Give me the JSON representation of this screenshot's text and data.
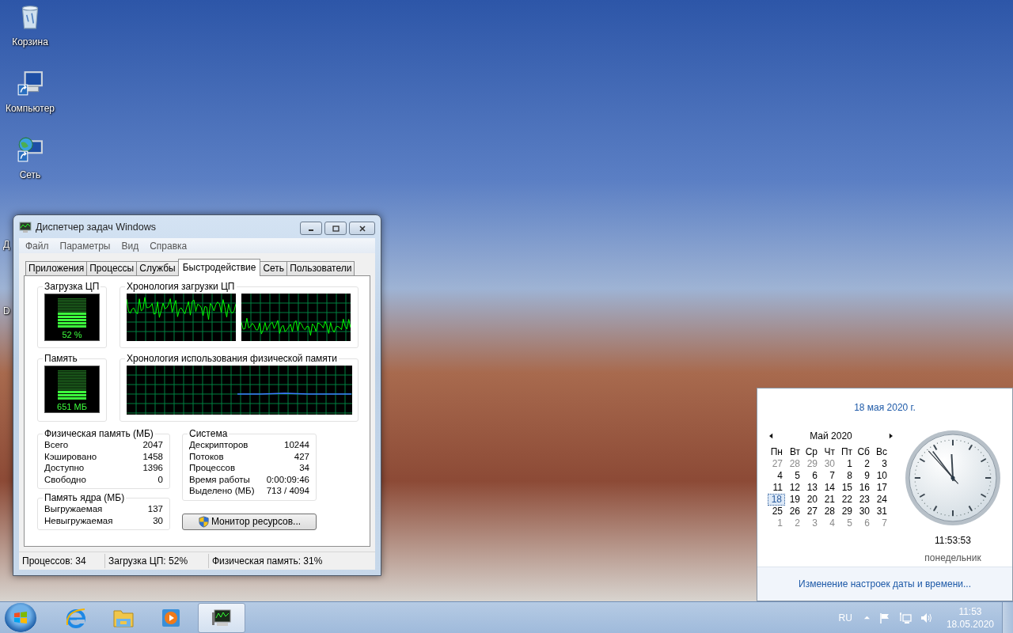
{
  "desktop_icons": [
    {
      "kind": "icon",
      "label": "Корзина"
    },
    {
      "kind": "icon",
      "label": "Компьютер"
    },
    {
      "kind": "icon",
      "label": "Сеть"
    },
    {
      "kind": "clipped",
      "label": "Д"
    },
    {
      "kind": "clipped",
      "label": "D"
    }
  ],
  "task_manager": {
    "title": "Диспетчер задач Windows",
    "menu": [
      "Файл",
      "Параметры",
      "Вид",
      "Справка"
    ],
    "tabs": [
      {
        "label": "Приложения",
        "selected": false
      },
      {
        "label": "Процессы",
        "selected": false
      },
      {
        "label": "Службы",
        "selected": false
      },
      {
        "label": "Быстродействие",
        "selected": true
      },
      {
        "label": "Сеть",
        "selected": false
      },
      {
        "label": "Пользователи",
        "selected": false
      }
    ],
    "cpu_usage": {
      "title": "Загрузка ЦП",
      "reading": "52 %",
      "level": 0.52
    },
    "cpu_history": {
      "title": "Хронология загрузки ЦП"
    },
    "memory": {
      "title": "Память",
      "reading": "651 МБ",
      "level": 0.31
    },
    "memory_history": {
      "title": "Хронология использования физической памяти"
    },
    "physical_memory": {
      "title": "Физическая память (МБ)",
      "rows": [
        {
          "label": "Всего",
          "value": "2047"
        },
        {
          "label": "Кэшировано",
          "value": "1458"
        },
        {
          "label": "Доступно",
          "value": "1396"
        },
        {
          "label": "Свободно",
          "value": "0"
        }
      ]
    },
    "kernel_memory": {
      "title": "Память ядра (МБ)",
      "rows": [
        {
          "label": "Выгружаемая",
          "value": "137"
        },
        {
          "label": "Невыгружаемая",
          "value": "30"
        }
      ]
    },
    "system": {
      "title": "Система",
      "rows": [
        {
          "label": "Дескрипторов",
          "value": "10244"
        },
        {
          "label": "Потоков",
          "value": "427"
        },
        {
          "label": "Процессов",
          "value": "34"
        },
        {
          "label": "Время работы",
          "value": "0:00:09:46"
        },
        {
          "label": "Выделено (МБ)",
          "value": "713 / 4094"
        }
      ]
    },
    "resource_monitor_button": "Монитор ресурсов...",
    "status_bar": [
      "Процессов: 34",
      "Загрузка ЦП: 52%",
      "Физическая память: 31%"
    ]
  },
  "calendar": {
    "date_link": "18 мая 2020 г.",
    "month": "Май 2020",
    "weekdays": [
      "Пн",
      "Вт",
      "Ср",
      "Чт",
      "Пт",
      "Сб",
      "Вс"
    ],
    "days": [
      {
        "label": "27",
        "in_month": false,
        "selected": false
      },
      {
        "label": "28",
        "in_month": false,
        "selected": false
      },
      {
        "label": "29",
        "in_month": false,
        "selected": false
      },
      {
        "label": "30",
        "in_month": false,
        "selected": false
      },
      {
        "label": "1",
        "in_month": true,
        "selected": false
      },
      {
        "label": "2",
        "in_month": true,
        "selected": false
      },
      {
        "label": "3",
        "in_month": true,
        "selected": false
      },
      {
        "label": "4",
        "in_month": true,
        "selected": false
      },
      {
        "label": "5",
        "in_month": true,
        "selected": false
      },
      {
        "label": "6",
        "in_month": true,
        "selected": false
      },
      {
        "label": "7",
        "in_month": true,
        "selected": false
      },
      {
        "label": "8",
        "in_month": true,
        "selected": false
      },
      {
        "label": "9",
        "in_month": true,
        "selected": false
      },
      {
        "label": "10",
        "in_month": true,
        "selected": false
      },
      {
        "label": "11",
        "in_month": true,
        "selected": false
      },
      {
        "label": "12",
        "in_month": true,
        "selected": false
      },
      {
        "label": "13",
        "in_month": true,
        "selected": false
      },
      {
        "label": "14",
        "in_month": true,
        "selected": false
      },
      {
        "label": "15",
        "in_month": true,
        "selected": false
      },
      {
        "label": "16",
        "in_month": true,
        "selected": false
      },
      {
        "label": "17",
        "in_month": true,
        "selected": false
      },
      {
        "label": "18",
        "in_month": true,
        "selected": true
      },
      {
        "label": "19",
        "in_month": true,
        "selected": false
      },
      {
        "label": "20",
        "in_month": true,
        "selected": false
      },
      {
        "label": "21",
        "in_month": true,
        "selected": false
      },
      {
        "label": "22",
        "in_month": true,
        "selected": false
      },
      {
        "label": "23",
        "in_month": true,
        "selected": false
      },
      {
        "label": "24",
        "in_month": true,
        "selected": false
      },
      {
        "label": "25",
        "in_month": true,
        "selected": false
      },
      {
        "label": "26",
        "in_month": true,
        "selected": false
      },
      {
        "label": "27",
        "in_month": true,
        "selected": false
      },
      {
        "label": "28",
        "in_month": true,
        "selected": false
      },
      {
        "label": "29",
        "in_month": true,
        "selected": false
      },
      {
        "label": "30",
        "in_month": true,
        "selected": false
      },
      {
        "label": "31",
        "in_month": true,
        "selected": false
      },
      {
        "label": "1",
        "in_month": false,
        "selected": false
      },
      {
        "label": "2",
        "in_month": false,
        "selected": false
      },
      {
        "label": "3",
        "in_month": false,
        "selected": false
      },
      {
        "label": "4",
        "in_month": false,
        "selected": false
      },
      {
        "label": "5",
        "in_month": false,
        "selected": false
      },
      {
        "label": "6",
        "in_month": false,
        "selected": false
      },
      {
        "label": "7",
        "in_month": false,
        "selected": false
      }
    ],
    "time": "11:53:53",
    "weekday": "понедельник",
    "settings_link": "Изменение настроек даты и времени..."
  },
  "taskbar": {
    "items": [
      {
        "kind": "start",
        "selected": false
      },
      {
        "kind": "browser",
        "selected": false
      },
      {
        "kind": "folder",
        "selected": false
      },
      {
        "kind": "player",
        "selected": false
      },
      {
        "kind": "monitor",
        "selected": true
      }
    ],
    "language": "RU",
    "time": "11:53",
    "date": "18.05.2020"
  }
}
